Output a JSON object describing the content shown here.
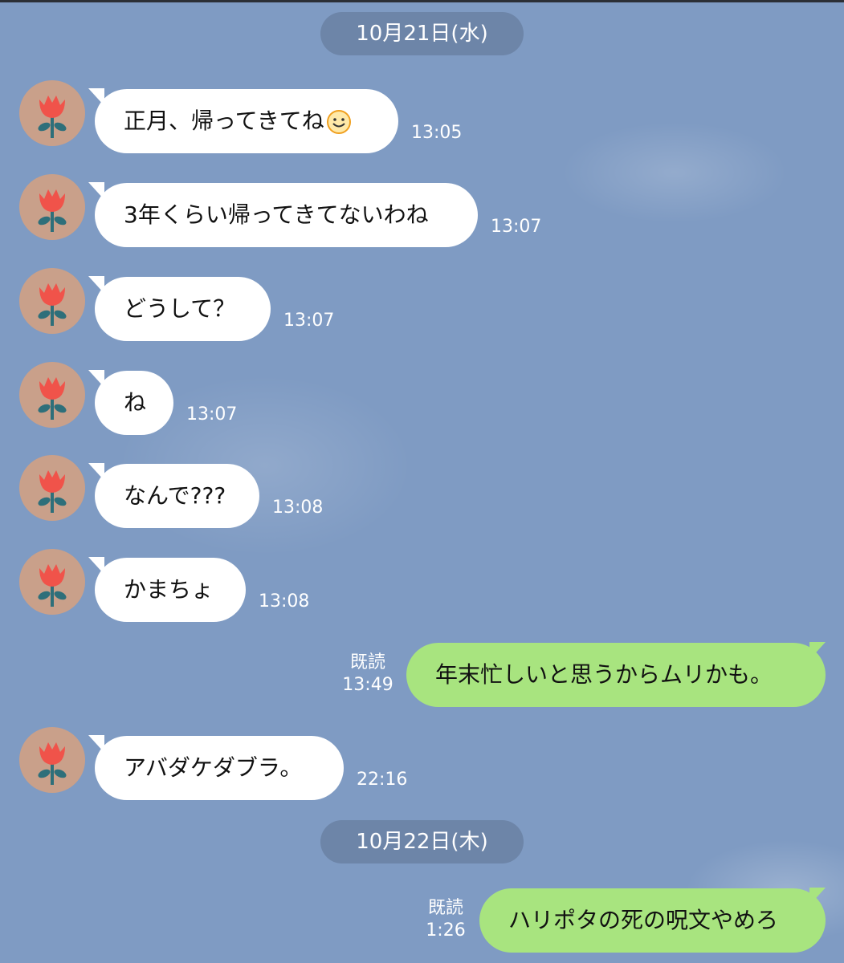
{
  "dates": [
    "10月21日(水)",
    "10月22日(木)"
  ],
  "read_label": "既読",
  "colors": {
    "background": "#7f9bc3",
    "incoming": "#ffffff",
    "outgoing": "#a8e47f",
    "date_pill": "#6d85a8"
  },
  "avatar_icon": "tulip-avatar-icon",
  "messages": [
    {
      "from": "other",
      "text": "正月、帰ってきてね",
      "emoji": "smile",
      "time": "13:05"
    },
    {
      "from": "other",
      "text": "3年くらい帰ってきてないわね",
      "time": "13:07"
    },
    {
      "from": "other",
      "text": "どうして？",
      "time": "13:07"
    },
    {
      "from": "other",
      "text": "ね",
      "time": "13:07"
    },
    {
      "from": "other",
      "text": "なんで???",
      "time": "13:08"
    },
    {
      "from": "other",
      "text": "かまちょ",
      "time": "13:08"
    },
    {
      "from": "me",
      "text": "年末忙しいと思うからムリかも。",
      "time": "13:49",
      "read": true
    },
    {
      "from": "other",
      "text": "アバダケダブラ。",
      "time": "22:16"
    },
    {
      "from": "me",
      "text": "ハリポタの死の呪文やめろ",
      "time": "1:26",
      "read": true
    }
  ]
}
